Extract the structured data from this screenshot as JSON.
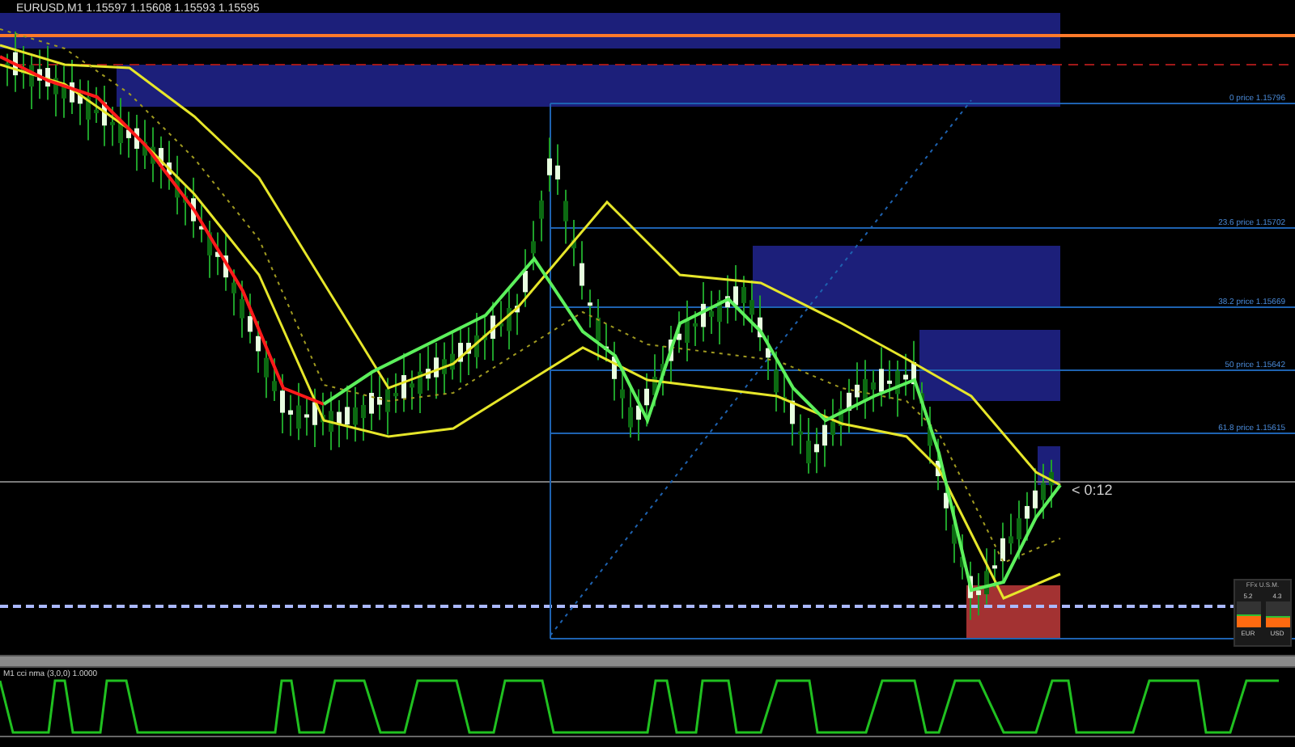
{
  "chart": {
    "title": "EURUSD,M1  1.15597 1.15608 1.15593 1.15595",
    "fib_levels": [
      "0 price 1.15796",
      "23.6 price 1.15702",
      "38.2 price 1.15669",
      "50 price 1.15642",
      "61.8 price 1.15615"
    ],
    "bar_timer": "< 0:12"
  },
  "strength_widget": {
    "title": "FFx U.S.M.",
    "currencies": [
      {
        "name": "EUR",
        "value": "5.2",
        "level": 0.5
      },
      {
        "name": "USD",
        "value": "4.3",
        "level": 0.43
      }
    ]
  },
  "indicator": {
    "title": "M1 cci nma (3,0,0) 1.0000"
  }
}
